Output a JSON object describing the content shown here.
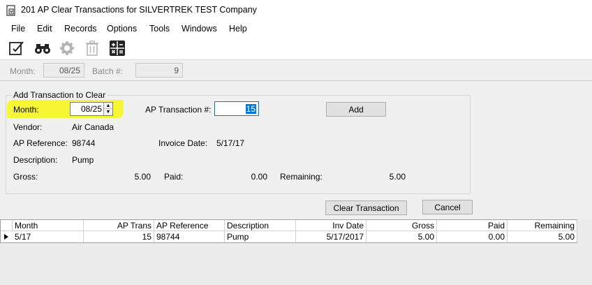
{
  "window": {
    "title": "201 AP Clear Transactions for SILVERTREK TEST Company"
  },
  "menu": [
    "File",
    "Edit",
    "Records",
    "Options",
    "Tools",
    "Windows",
    "Help"
  ],
  "toolbar": {
    "icons": [
      "edit-document-icon",
      "binoculars-icon",
      "gear-icon",
      "trash-icon",
      "calculator-icon"
    ]
  },
  "header": {
    "month_label": "Month:",
    "month_value": "08/25",
    "batch_label": "Batch #:",
    "batch_value": "9"
  },
  "add_group": {
    "title": "Add Transaction to Clear",
    "month_label": "Month:",
    "month_value": "08/25",
    "ap_trans_label": "AP Transaction #:",
    "ap_trans_value": "15",
    "add_button": "Add",
    "vendor_label": "Vendor:",
    "vendor_value": "Air Canada",
    "ap_ref_label": "AP Reference:",
    "ap_ref_value": "98744",
    "invoice_date_label": "Invoice Date:",
    "invoice_date_value": "5/17/17",
    "description_label": "Description:",
    "description_value": "Pump",
    "gross_label": "Gross:",
    "gross_value": "5.00",
    "paid_label": "Paid:",
    "paid_value": "0.00",
    "remaining_label": "Remaining:",
    "remaining_value": "5.00"
  },
  "actions": {
    "clear_button": "Clear Transaction",
    "cancel_button": "Cancel"
  },
  "grid": {
    "columns": [
      "Month",
      "AP Trans",
      "AP Reference",
      "Description",
      "Inv Date",
      "Gross",
      "Paid",
      "Remaining"
    ],
    "rows": [
      [
        "5/17",
        "15",
        "98744",
        "Pump",
        "5/17/2017",
        "5.00",
        "0.00",
        "5.00"
      ]
    ]
  }
}
